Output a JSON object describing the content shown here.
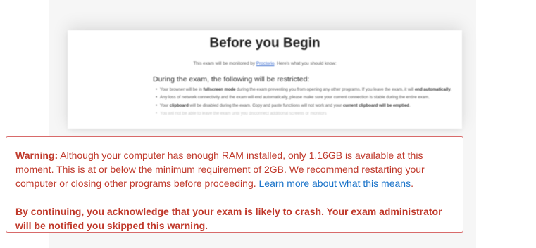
{
  "preview": {
    "title": "Before you Begin",
    "intro_before": "This exam will be monitored by ",
    "intro_link": "Proctorio",
    "intro_after": ". Here's what you should know:",
    "heading": "During the exam, the following will be restricted:",
    "bullets": [
      {
        "a": "Your browser will be in ",
        "b": "fullscreen mode",
        "c": " during the exam preventing you from opening any other programs. If you leave the exam, it will ",
        "d": "end automatically",
        "e": "."
      },
      {
        "a": "Any loss of network connectivity and the exam will end automatically, please make sure your current connection is stable during the entire exam.",
        "b": "",
        "c": "",
        "d": "",
        "e": ""
      },
      {
        "a": "Your ",
        "b": "clipboard",
        "c": " will be disabled during the exam. Copy and paste functions will not work and your ",
        "d": "current clipboard will be emptied",
        "e": "."
      },
      {
        "a": "You will not be able to leave the exam until you disconnect additional screens or monitors",
        "b": "",
        "c": "",
        "d": "",
        "e": ""
      }
    ]
  },
  "warning": {
    "label": "Warning:",
    "message": " Although your computer has enough RAM installed, only 1.16GB is available at this moment. This is at or below the minimum requirement of 2GB. We recommend restarting your computer or closing other programs before proceeding. ",
    "link": "Learn more about what this means",
    "after_link": ".",
    "acknowledgement": "By continuing, you acknowledge that your exam is likely to crash. Your exam administrator will be notified you skipped this warning."
  }
}
